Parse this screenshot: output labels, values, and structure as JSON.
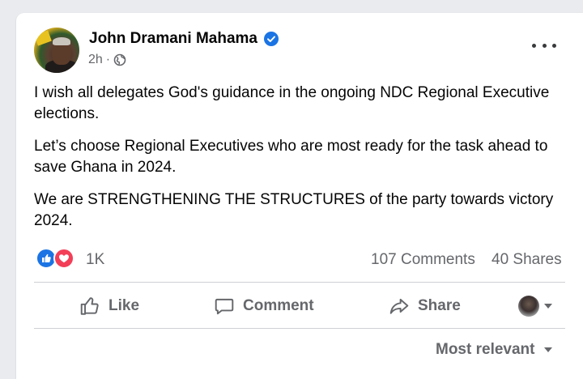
{
  "post": {
    "author": "John Dramani Mahama",
    "time": "2h",
    "separator": "·",
    "paragraphs": [
      "I wish all delegates God's guidance in the ongoing NDC Regional Executive elections.",
      "Let’s choose Regional Executives who are most ready for the task ahead to save Ghana in 2024.",
      "We are STRENGTHENING THE STRUCTURES of the party towards victory 2024."
    ]
  },
  "stats": {
    "reactions_count": "1K",
    "comments": "107 Comments",
    "shares": "40 Shares"
  },
  "actions": {
    "like": "Like",
    "comment": "Comment",
    "share": "Share"
  },
  "comments": {
    "sort_label": "Most relevant"
  },
  "icons": {
    "verified": "verified-badge-icon",
    "privacy": "globe-icon",
    "more": "more-options-icon",
    "like_reaction": "like-reaction-icon",
    "love_reaction": "love-reaction-icon"
  },
  "colors": {
    "brand_blue": "#1b74e4",
    "love_red": "#f33e58",
    "secondary_text": "#65676b"
  }
}
